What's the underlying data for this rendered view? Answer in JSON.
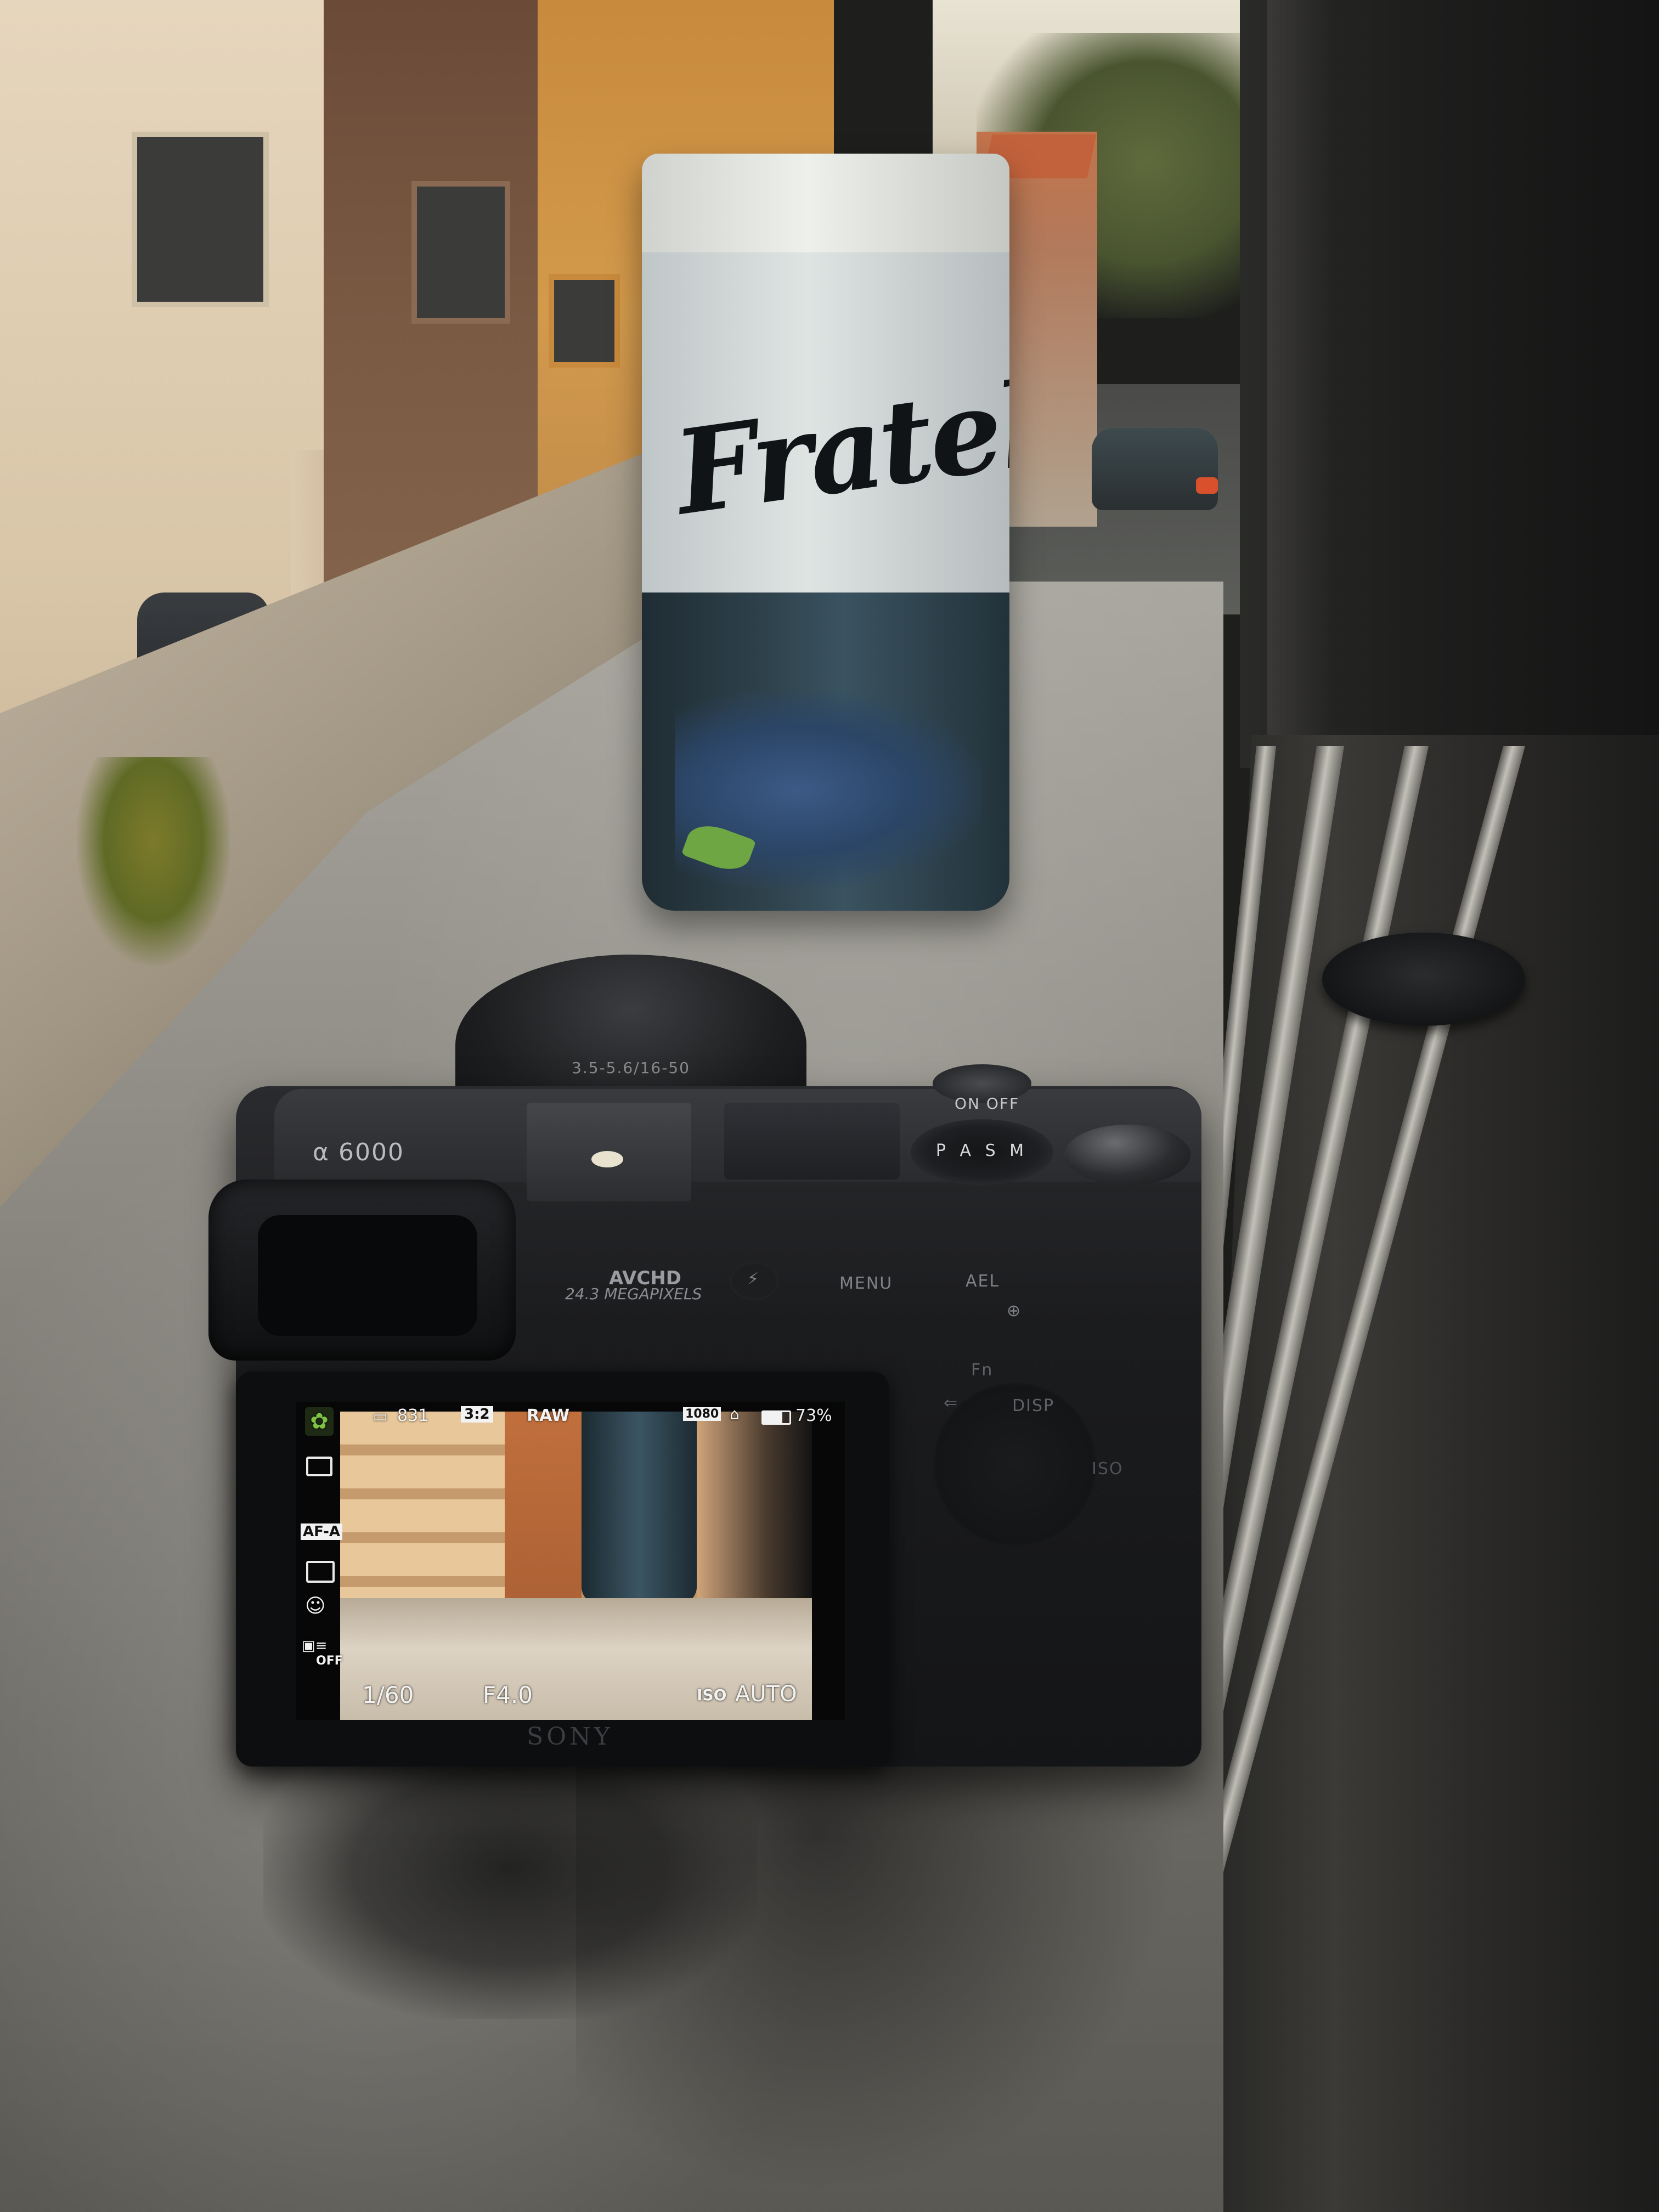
{
  "tin": {
    "brand": "Fratel"
  },
  "camera": {
    "model": "α 6000",
    "lens_marking": "3.5-5.6/16-50",
    "power_label": "ON OFF",
    "mode_dial": "P A S M",
    "format_badge": "AVCHD",
    "megapixels": "24.3 MEGAPIXELS",
    "buttons": {
      "menu": "MENU",
      "ael": "AEL",
      "fn": "Fn",
      "disp": "DISP",
      "iso": "ISO"
    },
    "brand": "SONY"
  },
  "screen": {
    "shots_remaining": "831",
    "aspect_ratio": "3:2",
    "quality": "RAW",
    "movie_size": "1080",
    "battery": "73%",
    "focus_mode": "AF-A",
    "steady_shot": "OFF",
    "shutter_speed": "1/60",
    "aperture": "F4.0",
    "iso_label": "ISO",
    "iso_value": "AUTO"
  },
  "colors": {
    "osd_text": "#f2f2f2",
    "scene_icon": "#7fc242",
    "camera_body": "#1b1c1e"
  }
}
